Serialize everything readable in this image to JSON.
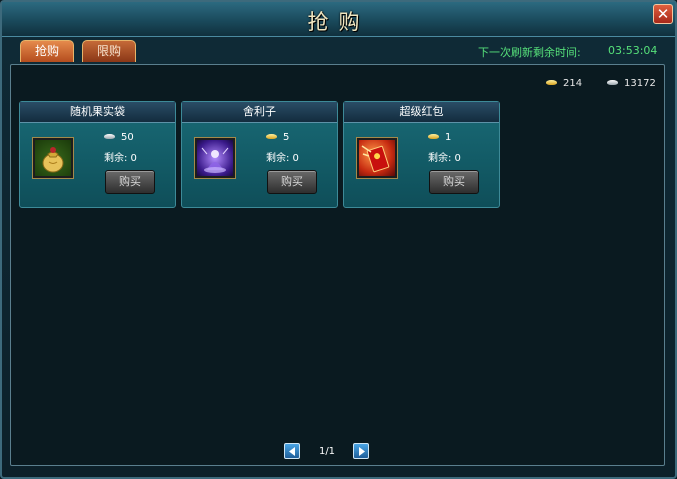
{
  "window": {
    "title": "抢购",
    "close_label": "✕"
  },
  "tabs": [
    {
      "label": "抢购",
      "active": true
    },
    {
      "label": "限购",
      "active": false
    }
  ],
  "timer": {
    "label": "下一次刷新剩余时间:",
    "value": "03:53:04"
  },
  "currency": {
    "gold": "214",
    "silver": "13172"
  },
  "items": [
    {
      "name": "随机果实袋",
      "price": "50",
      "remain": "剩余: 0",
      "buy_label": "购买",
      "icon": "fruit-bag-icon"
    },
    {
      "name": "舍利子",
      "price": "5",
      "remain": "剩余: 0",
      "buy_label": "购买",
      "icon": "sarira-icon"
    },
    {
      "name": "超级红包",
      "price": "1",
      "remain": "剩余: 0",
      "buy_label": "购买",
      "icon": "red-envelope-icon"
    }
  ],
  "pagination": {
    "page": "1/1"
  },
  "colors": {
    "accent_green": "#56e07a",
    "tab_orange": "#e58a4c",
    "card_teal": "#1a6a76"
  }
}
